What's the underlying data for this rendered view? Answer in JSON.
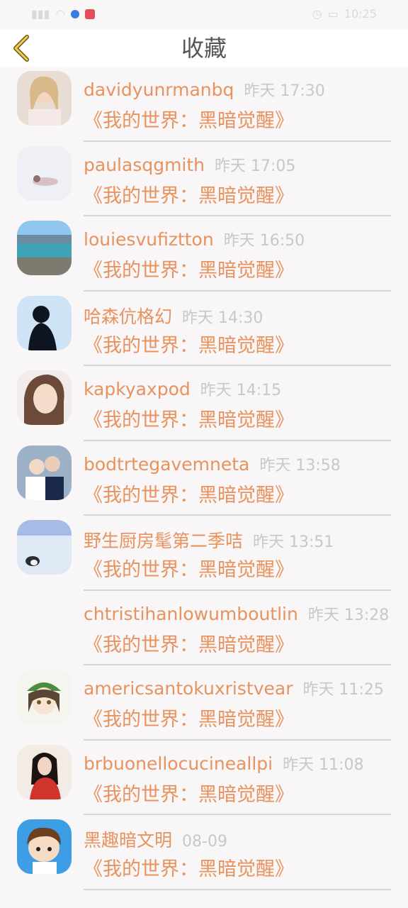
{
  "status_bar": {
    "time": "10:25"
  },
  "header": {
    "title": "收藏"
  },
  "items": [
    {
      "name": "davidyunrmanbq",
      "time": "昨天 17:30",
      "subtitle": "《我的世界：黑暗觉醒》",
      "avatar": "portrait-blonde-woman"
    },
    {
      "name": "paulasqgmith",
      "time": "昨天 17:05",
      "subtitle": "《我的世界：黑暗觉醒》",
      "avatar": "snow-scene"
    },
    {
      "name": "louiesvufiztton",
      "time": "昨天 16:50",
      "subtitle": "《我的世界：黑暗觉醒》",
      "avatar": "lake-landscape"
    },
    {
      "name": "哈森伉格幻",
      "time": "昨天 14:30",
      "subtitle": "《我的世界：黑暗觉醒》",
      "avatar": "silhouette-person"
    },
    {
      "name": "kapkyaxpod",
      "time": "昨天 14:15",
      "subtitle": "《我的世界：黑暗觉醒》",
      "avatar": "portrait-woman"
    },
    {
      "name": "bodtrtegavemneta",
      "time": "昨天 13:58",
      "subtitle": "《我的世界：黑暗觉醒》",
      "avatar": "couple-photo"
    },
    {
      "name": "野生厨房髦第二季咭",
      "time": "昨天 13:51",
      "subtitle": "《我的世界：黑暗觉醒》",
      "avatar": "penguin-ice"
    },
    {
      "name": "chtristihanlowumboutlin",
      "time": "昨天 13:28",
      "subtitle": "《我的世界：黑暗觉醒》",
      "avatar": ""
    },
    {
      "name": "americsantokuxristvear",
      "time": "昨天 11:25",
      "subtitle": "《我的世界：黑暗觉醒》",
      "avatar": "anime-girl"
    },
    {
      "name": "brbuonellocucineallpi",
      "time": "昨天 11:08",
      "subtitle": "《我的世界：黑暗觉醒》",
      "avatar": "red-dress-woman"
    },
    {
      "name": "黑趣暗文明",
      "time": "08-09",
      "subtitle": "《我的世界：黑暗觉醒》",
      "avatar": "cartoon-boy"
    }
  ]
}
